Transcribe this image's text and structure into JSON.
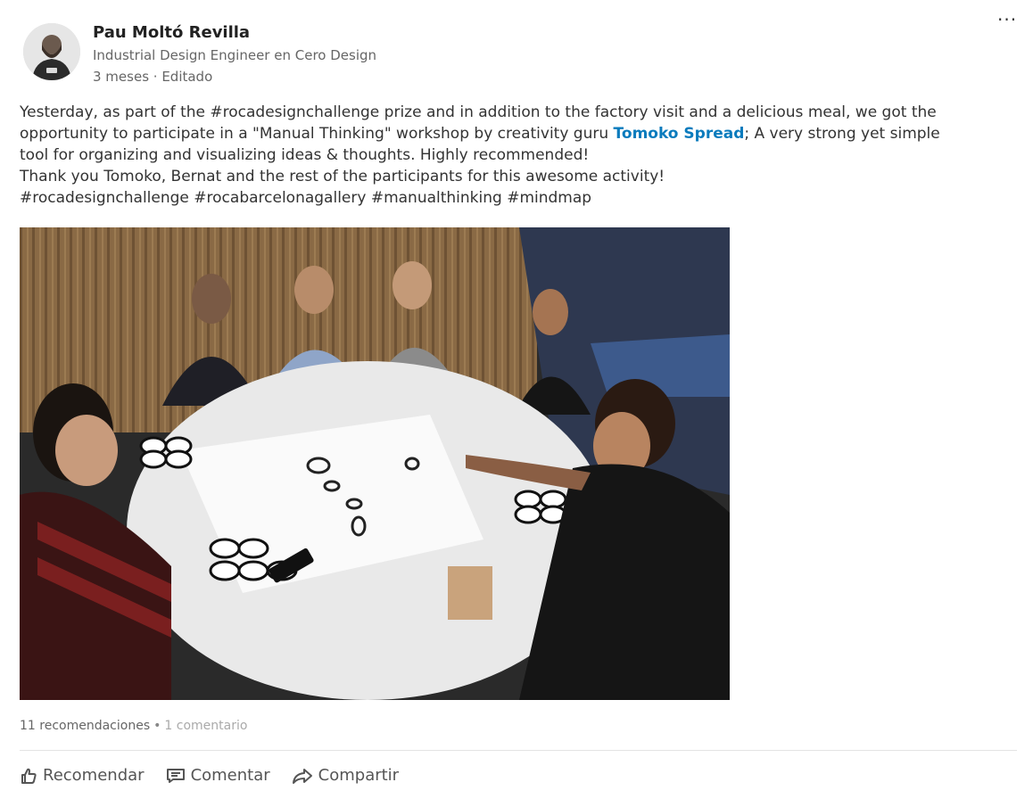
{
  "post": {
    "author": {
      "name": "Pau Moltó Revilla",
      "headline": "Industrial Design Engineer en Cero Design",
      "meta": "3 meses · Editado"
    },
    "menu_icon": "more-horizontal-icon",
    "text": {
      "line1": "Yesterday, as part of the #rocadesignchallenge prize and in addition to the factory visit and a delicious meal, we got the",
      "line2_before": "opportunity to participate in a \"Manual Thinking\" workshop by creativity guru ",
      "mention": "Tomoko Spread",
      "line2_after": "; A very strong yet simple",
      "line3": "tool for organizing and visualizing ideas & thoughts. Highly recommended!",
      "line4": "Thank you Tomoko, Bernat and the rest of the participants for this awesome activity!",
      "line5": "#rocadesignchallenge #rocabarcelonagallery #manualthinking #mindmap"
    },
    "stats": {
      "likes": "11 recomendaciones",
      "separator": "•",
      "comments": "1 comentario"
    },
    "actions": [
      {
        "label": "Recomendar",
        "icon": "thumbs-up-icon"
      },
      {
        "label": "Comentar",
        "icon": "comment-icon"
      },
      {
        "label": "Compartir",
        "icon": "share-icon"
      }
    ],
    "colors": {
      "mention": "#0a7bbd",
      "text": "#333333",
      "muted": "#666666"
    }
  }
}
